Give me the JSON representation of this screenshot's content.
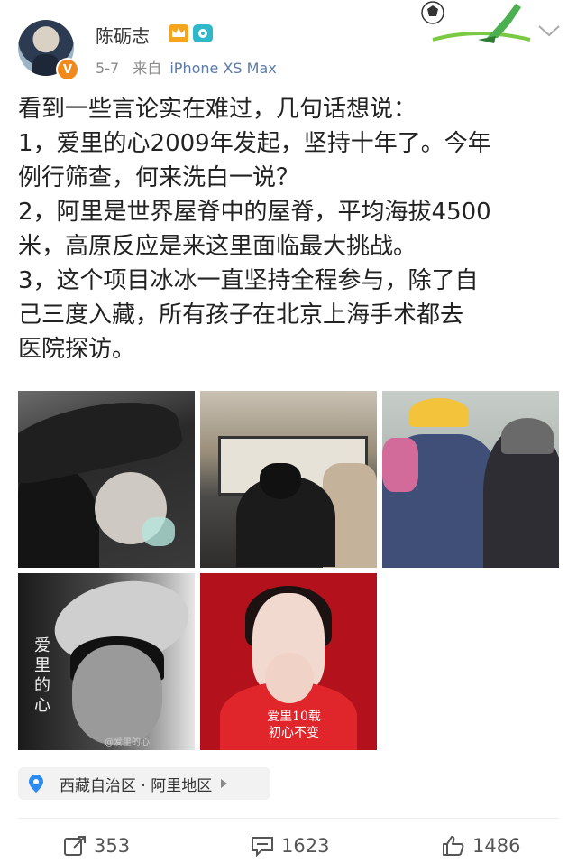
{
  "post": {
    "username": "陈砺志",
    "date": "5-7",
    "source_prefix": "来自",
    "source_device": "iPhone XS Max",
    "content": "看到一些言论实在难过，几句话想说：\n1，爱里的心2009年发起，坚持十年了。今年\n例行筛查，何来洗白一说？\n2，阿里是世界屋脊中的屋脊，平均海拔4500\n米，高原反应是来这里面临最大挑战。\n3，这个项目冰冰一直坚持全程参与，除了自\n己三度入藏，所有孩子在北京上海手术都去\n医院探访。"
  },
  "images": {
    "poster1_title": "爱里的心",
    "poster1_watermark": "@爱里的心",
    "poster2_title": "爱里10载\n初心不变"
  },
  "location": {
    "text": "西藏自治区 · 阿里地区"
  },
  "actions": {
    "repost": "353",
    "comment": "1623",
    "like": "1486"
  },
  "icons": {
    "verified": "verified-v-icon",
    "crown": "vip-crown-icon",
    "camera": "camera-badge-icon",
    "location": "location-pin-icon",
    "repost": "repost-icon",
    "comment": "comment-icon",
    "like": "thumbs-up-icon",
    "menu": "chevron-down-icon"
  },
  "colors": {
    "accent": "#f18a1c",
    "link": "#5b7aa8",
    "location_pin": "#2a8cf0"
  }
}
